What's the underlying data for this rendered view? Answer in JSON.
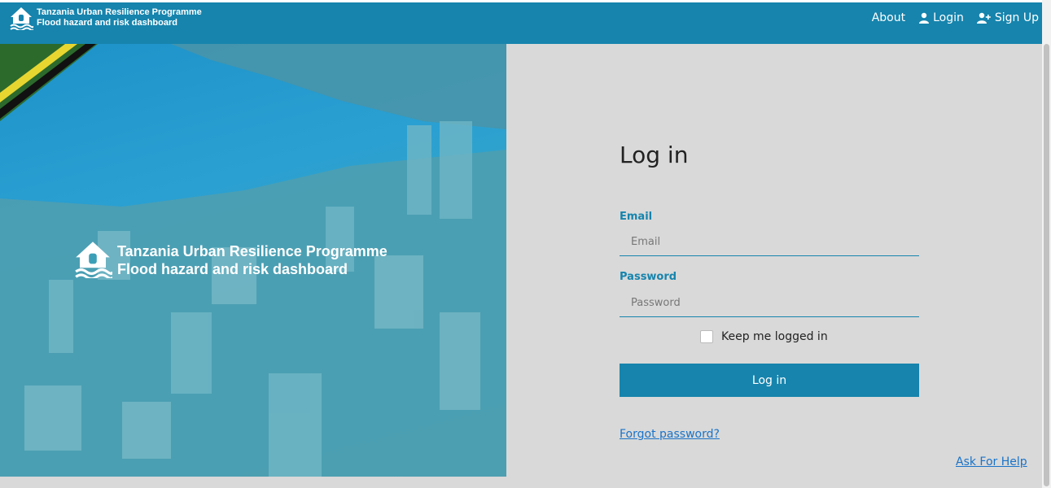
{
  "brand": {
    "line1": "Tanzania Urban Resilience Programme",
    "line2": "Flood hazard and risk dashboard",
    "icon": "house-flood-icon"
  },
  "nav": {
    "about": "About",
    "login": "Login",
    "signup": "Sign Up"
  },
  "hero": {
    "line1": "Tanzania Urban Resilience Programme",
    "line2": "Flood hazard and risk dashboard"
  },
  "form": {
    "title": "Log in",
    "email_label": "Email",
    "email_placeholder": "Email",
    "email_value": "",
    "password_label": "Password",
    "password_placeholder": "Password",
    "password_value": "",
    "remember_label": "Keep me logged in",
    "remember_checked": false,
    "submit_label": "Log in",
    "forgot_link": "Forgot password?"
  },
  "help_link": "Ask For Help",
  "colors": {
    "primary": "#1684ad",
    "background": "#d9d9d9",
    "link": "#1a73c9"
  }
}
